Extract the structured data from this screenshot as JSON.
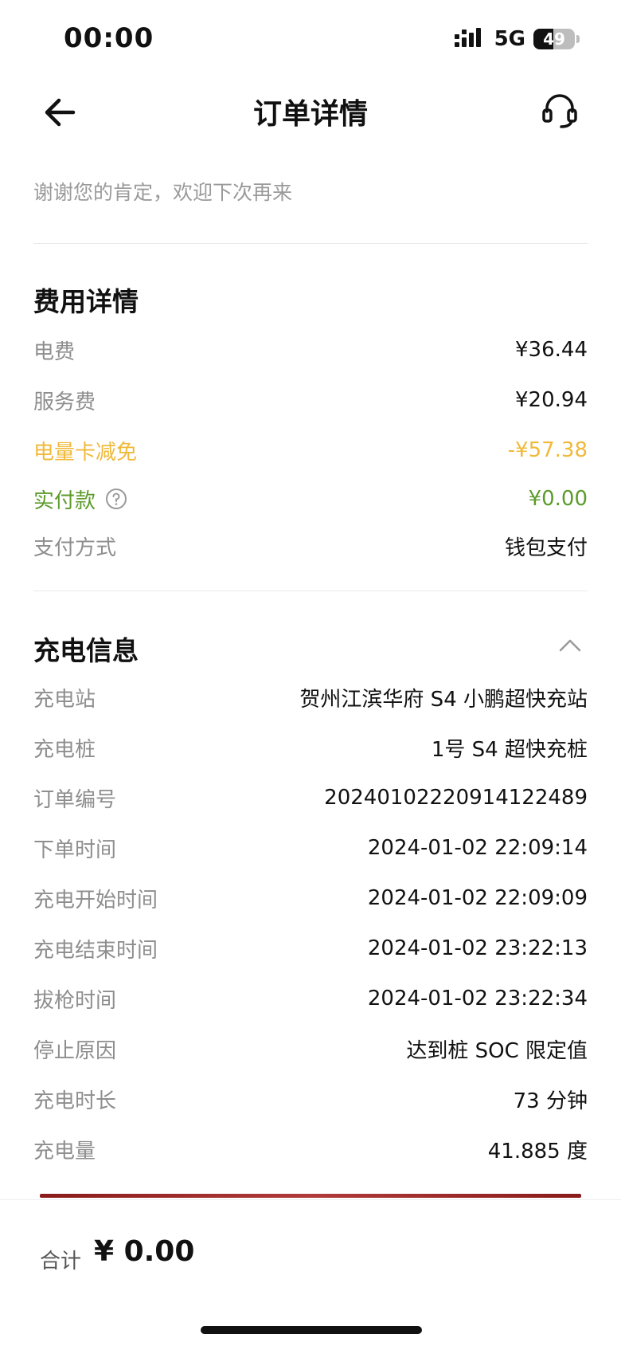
{
  "status_bar": {
    "time": "00:00",
    "network": "5G",
    "battery_level": "49",
    "battery_fraction": 0.49
  },
  "header": {
    "title": "订单详情",
    "back_icon": "arrow-left-icon",
    "support_icon": "headset-icon"
  },
  "thanks_message": "谢谢您的肯定，欢迎下次再来",
  "fee_details": {
    "title": "费用详情",
    "rows": [
      {
        "label": "电费",
        "value": "¥36.44"
      },
      {
        "label": "服务费",
        "value": "¥20.94"
      },
      {
        "label": "电量卡减免",
        "value": "-¥57.38"
      },
      {
        "label": "实付款",
        "value": "¥0.00"
      },
      {
        "label": "支付方式",
        "value": "钱包支付"
      }
    ],
    "colors": {
      "discount": "#f0b93a",
      "paid": "#5d9b2c"
    }
  },
  "charge_info": {
    "title": "充电信息",
    "collapse_icon": "chevron-up-icon",
    "rows": [
      {
        "label": "充电站",
        "value": "贺州江滨华府 S4 小鹏超快充站"
      },
      {
        "label": "充电桩",
        "value": "1号 S4 超快充桩"
      },
      {
        "label": "订单编号",
        "value": "20240102220914122489"
      },
      {
        "label": "下单时间",
        "value": "2024-01-02 22:09:14"
      },
      {
        "label": "充电开始时间",
        "value": "2024-01-02 22:09:09"
      },
      {
        "label": "充电结束时间",
        "value": "2024-01-02 23:22:13"
      },
      {
        "label": "拔枪时间",
        "value": "2024-01-02 23:22:34"
      },
      {
        "label": "停止原因",
        "value": "达到桩 SOC 限定值"
      },
      {
        "label": "充电时长",
        "value": "73 分钟"
      },
      {
        "label": "充电量",
        "value": "41.885 度"
      }
    ]
  },
  "footer": {
    "total_label": "合计",
    "total_value": "¥ 0.00"
  }
}
